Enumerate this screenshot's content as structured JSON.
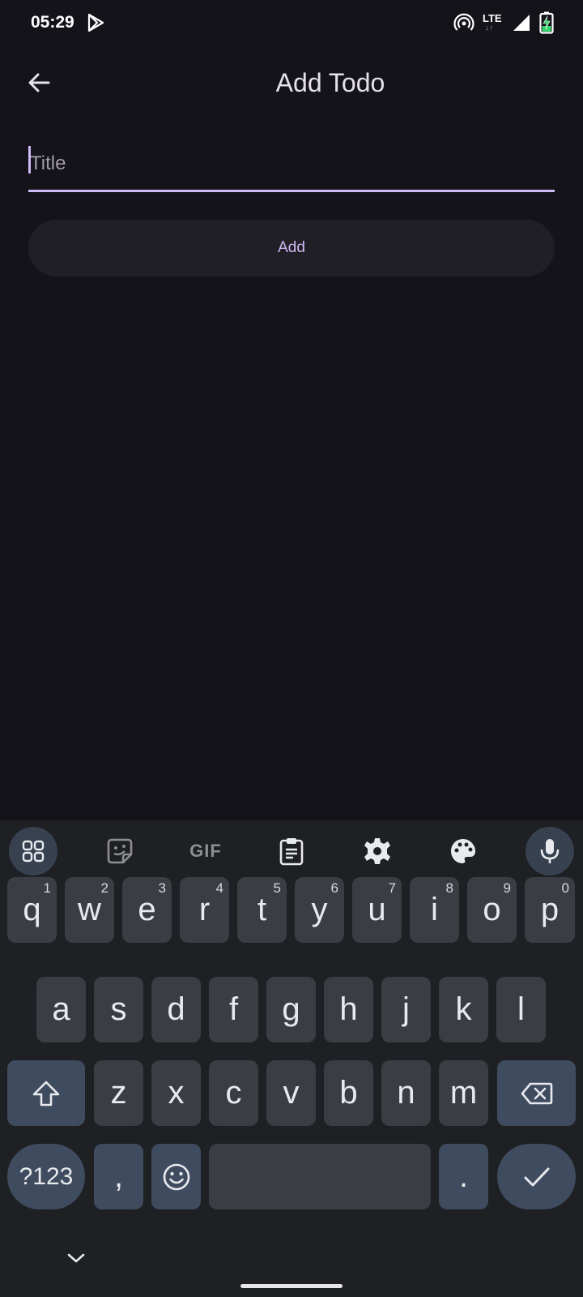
{
  "status_bar": {
    "time": "05:29",
    "network": "LTE",
    "icons": [
      "play-store-icon",
      "hotspot-icon",
      "lte-icon",
      "signal-icon",
      "battery-charging-icon"
    ]
  },
  "app_bar": {
    "title": "Add Todo",
    "back_icon": "arrow-back-icon"
  },
  "form": {
    "title_field": {
      "placeholder": "Title",
      "value": ""
    },
    "add_label": "Add"
  },
  "keyboard": {
    "toolbar": [
      "apps-grid-icon",
      "sticker-icon",
      "gif-icon",
      "clipboard-icon",
      "settings-gear-icon",
      "palette-icon",
      "microphone-icon"
    ],
    "gif_label": "GIF",
    "row1": [
      {
        "label": "q",
        "hint": "1"
      },
      {
        "label": "w",
        "hint": "2"
      },
      {
        "label": "e",
        "hint": "3"
      },
      {
        "label": "r",
        "hint": "4"
      },
      {
        "label": "t",
        "hint": "5"
      },
      {
        "label": "y",
        "hint": "6"
      },
      {
        "label": "u",
        "hint": "7"
      },
      {
        "label": "i",
        "hint": "8"
      },
      {
        "label": "o",
        "hint": "9"
      },
      {
        "label": "p",
        "hint": "0"
      }
    ],
    "row2": [
      "a",
      "s",
      "d",
      "f",
      "g",
      "h",
      "j",
      "k",
      "l"
    ],
    "row3": [
      "z",
      "x",
      "c",
      "v",
      "b",
      "n",
      "m"
    ],
    "symbols_label": "?123",
    "comma_label": ",",
    "period_label": ".",
    "accent_color": "#cdb9f5"
  }
}
